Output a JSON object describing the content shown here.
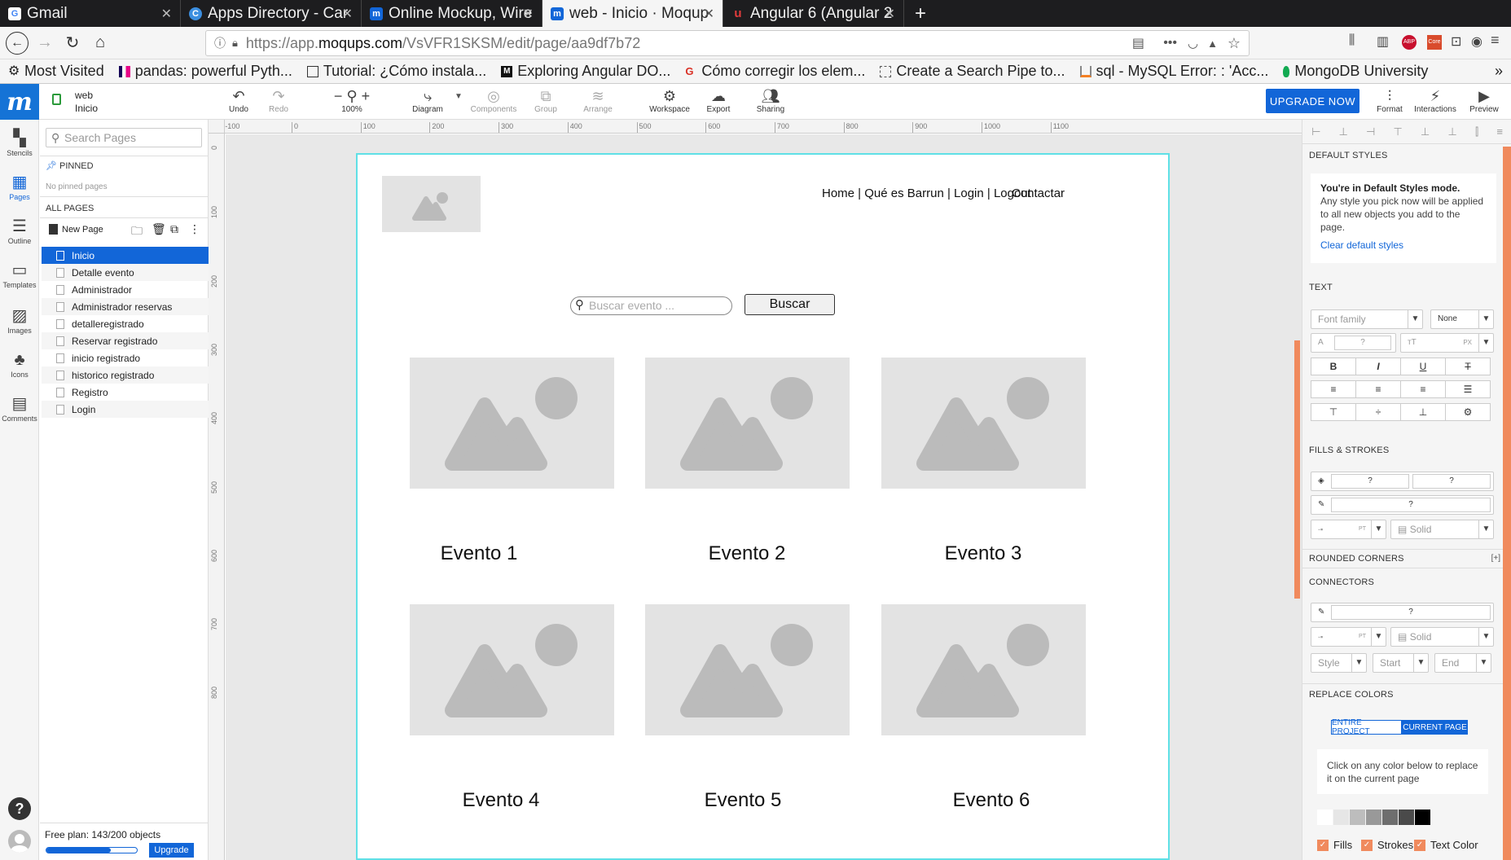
{
  "browser": {
    "tabs": [
      {
        "title": "Gmail",
        "icon": "google-icon",
        "color": "#ffffff",
        "letter": "G"
      },
      {
        "title": "Apps Directory - Car",
        "icon": "canva-icon",
        "color": "#3c8fe0",
        "letter": "C"
      },
      {
        "title": "Online Mockup, Wire",
        "icon": "moqups-icon",
        "color": "#1266d8",
        "letter": "m"
      },
      {
        "title": "web - Inicio · Moqup",
        "icon": "moqups-icon",
        "color": "#1266d8",
        "letter": "m"
      },
      {
        "title": "Angular 6 (Angular 2",
        "icon": "udemy-icon",
        "color": "#e23c3c",
        "letter": "u"
      }
    ],
    "url_prefix": "https://app.",
    "url_domain": "moqups.com",
    "url_path": "/VsVFR1SKSM/edit/page/aa9df7b72",
    "bookmarks": [
      "Most Visited",
      "pandas: powerful Pyth...",
      "Tutorial: ¿Cómo instala...",
      "Exploring Angular DO...",
      "Cómo corregir los elem...",
      "Create a Search Pipe to...",
      "sql - MySQL Error: : 'Acc...",
      "MongoDB University"
    ]
  },
  "toolbar": {
    "project": "web",
    "page": "Inicio",
    "undo": "Undo",
    "redo": "Redo",
    "zoom": "100%",
    "diagram": "Diagram",
    "components": "Components",
    "group": "Group",
    "arrange": "Arrange",
    "workspace": "Workspace",
    "export": "Export",
    "sharing": "Sharing",
    "upgrade": "UPGRADE NOW",
    "format": "Format",
    "interactions": "Interactions",
    "preview": "Preview"
  },
  "rail": {
    "stencils": "Stencils",
    "pages": "Pages",
    "outline": "Outline",
    "templates": "Templates",
    "images": "Images",
    "icons": "Icons",
    "comments": "Comments"
  },
  "pages_panel": {
    "search_placeholder": "Search Pages",
    "pinned": "PINNED",
    "no_pinned": "No pinned pages",
    "all_pages": "ALL PAGES",
    "new_page": "New Page",
    "items": [
      "Inicio",
      "Detalle evento",
      "Administrador",
      "Administrador reservas",
      "detalleregistrado",
      "Reservar registrado",
      "inicio registrado",
      "historico registrado",
      "Registro",
      "Login"
    ],
    "selected": "Inicio",
    "plan_text": "Free plan: 143/200 objects",
    "plan_usage": 0.715,
    "upgrade": "Upgrade"
  },
  "rulers": {
    "h": [
      "-100",
      "0",
      "100",
      "200",
      "300",
      "400",
      "500",
      "600",
      "700",
      "800",
      "900",
      "1000",
      "1100"
    ],
    "v": [
      "0",
      "100",
      "200",
      "300",
      "400",
      "500",
      "600",
      "700",
      "800"
    ]
  },
  "mockup": {
    "nav_links": "Home | Qué es Barrun | Login | Logout",
    "contact": "Contactar",
    "search_placeholder": "Buscar evento ...",
    "search_button": "Buscar",
    "events": [
      "Evento 1",
      "Evento 2",
      "Evento 3",
      "Evento 4",
      "Evento 5",
      "Evento 6"
    ]
  },
  "right_panel": {
    "default_styles": "DEFAULT STYLES",
    "mode_title": "You're in Default Styles mode.",
    "mode_text": "Any style you pick now will be applied to all new objects you add to the page.",
    "clear": "Clear default styles",
    "text": "TEXT",
    "font_family": "Font family",
    "font_none": "None",
    "size_q": "?",
    "px": "PX",
    "fills_strokes": "FILLS & STROKES",
    "q": "?",
    "pt": "PT",
    "solid": "Solid",
    "rounded": "ROUNDED CORNERS",
    "rounded_add": "[+]",
    "connectors": "CONNECTORS",
    "style": "Style",
    "start": "Start",
    "end": "End",
    "replace_colors": "REPLACE COLORS",
    "entire_project": "ENTIRE PROJECT",
    "current_page": "CURRENT PAGE",
    "replace_hint": "Click on any color below to replace it on the current page",
    "swatches": [
      "#ffffff",
      "#e6e6e6",
      "#bdbdbd",
      "#999999",
      "#6e6e6e",
      "#4a4a4a",
      "#000000"
    ],
    "fills": "Fills",
    "strokes": "Strokes",
    "text_color": "Text Color"
  },
  "colors": {
    "accent": "#1266d8",
    "selection": "#5fe0e6",
    "scroll": "#f08a5d"
  }
}
